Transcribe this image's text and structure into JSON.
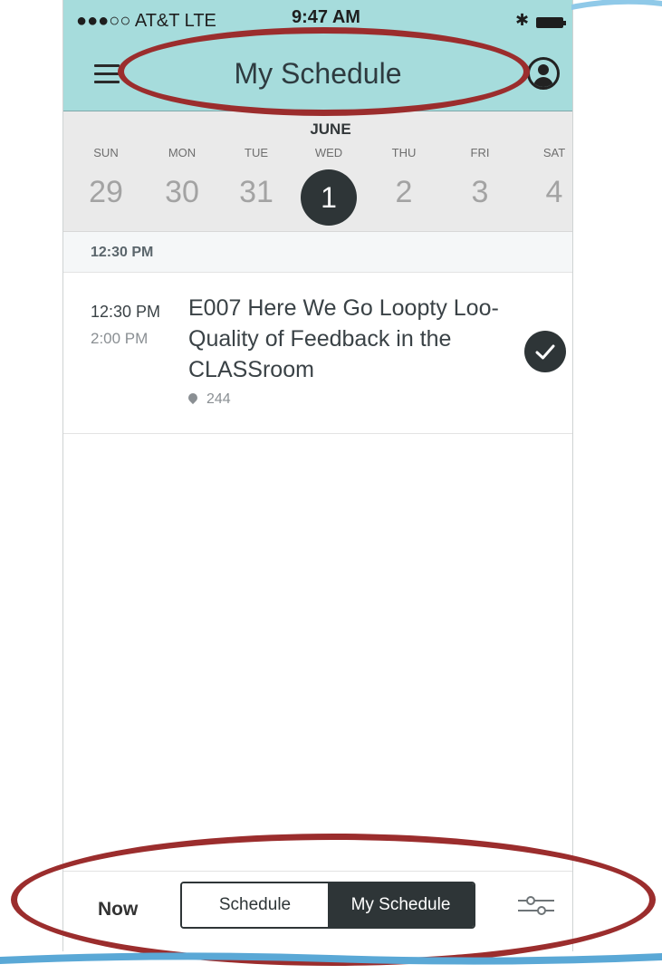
{
  "status_bar": {
    "signal": "●●●○○ AT&T  LTE",
    "time": "9:47 AM"
  },
  "header": {
    "title": "My Schedule"
  },
  "calendar": {
    "month": "JUNE",
    "days": [
      {
        "dow": "SUN",
        "day": "29"
      },
      {
        "dow": "MON",
        "day": "30"
      },
      {
        "dow": "TUE",
        "day": "31"
      },
      {
        "dow": "WED",
        "day": "1"
      },
      {
        "dow": "THU",
        "day": "2"
      },
      {
        "dow": "FRI",
        "day": "3"
      },
      {
        "dow": "SAT",
        "day": "4"
      }
    ],
    "selected_day": "1"
  },
  "schedule": {
    "section_time": "12:30 PM",
    "sessions": [
      {
        "start": "12:30 PM",
        "end": "2:00 PM",
        "title": "E007 Here We Go Loopty Loo-Quality of Feedback in the CLASSroom",
        "location": "244",
        "added": true
      }
    ]
  },
  "bottom_bar": {
    "now_label": "Now",
    "segments": [
      "Schedule",
      "My Schedule"
    ],
    "active_segment": "My Schedule"
  },
  "colors": {
    "header_bg": "#a6dcdc",
    "dark": "#2e3537",
    "annotation": "#9b2d2d",
    "calendar_bg": "#eaeaea"
  },
  "icons": [
    "menu-icon",
    "avatar-icon",
    "bluetooth-icon",
    "battery-icon",
    "location-pin-icon",
    "checkmark-icon",
    "filter-sliders-icon"
  ]
}
